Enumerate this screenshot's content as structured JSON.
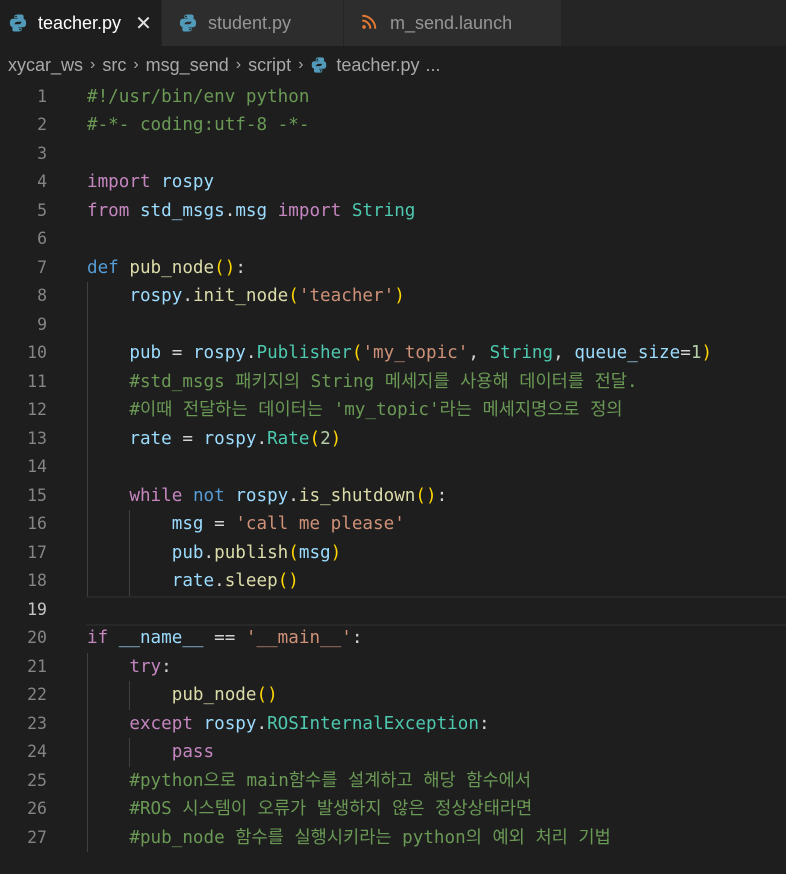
{
  "tabs": [
    {
      "label": "teacher.py",
      "icon": "python-icon",
      "active": true
    },
    {
      "label": "student.py",
      "icon": "python-icon",
      "active": false
    },
    {
      "label": "m_send.launch",
      "icon": "rss-icon",
      "active": false
    }
  ],
  "tab_close_glyph": "✕",
  "breadcrumb": {
    "items": [
      "xycar_ws",
      "src",
      "msg_send",
      "script",
      "teacher.py",
      "..."
    ],
    "separator": "›"
  },
  "editor": {
    "current_line": 19,
    "lines": [
      "#!/usr/bin/env python",
      "#-*- coding:utf-8 -*-",
      "",
      "import rospy",
      "from std_msgs.msg import String",
      "",
      "def pub_node():",
      "    rospy.init_node('teacher')",
      "",
      "    pub = rospy.Publisher('my_topic', String, queue_size=1)",
      "    #std_msgs 패키지의 String 메세지를 사용해 데이터를 전달.",
      "    #이때 전달하는 데이터는 'my_topic'라는 메세지명으로 정의",
      "    rate = rospy.Rate(2)",
      "",
      "    while not rospy.is_shutdown():",
      "        msg = 'call me please'",
      "        pub.publish(msg)",
      "        rate.sleep()",
      "",
      "if __name__ == '__main__':",
      "    try:",
      "        pub_node()",
      "    except rospy.ROSInternalException:",
      "        pass",
      "    #python으로 main함수를 설계하고 해당 함수에서",
      "    #ROS 시스템이 오류가 발생하지 않은 정상상태라면",
      "    #pub_node 함수를 실행시키라는 python의 예외 처리 기법"
    ]
  },
  "colors": {
    "background": "#1e1e1e",
    "tabbar": "#252526",
    "comment": "#6a9955",
    "keyword": "#c586c0",
    "function": "#dcdcaa",
    "string": "#ce9178",
    "type": "#4ec9b0"
  }
}
